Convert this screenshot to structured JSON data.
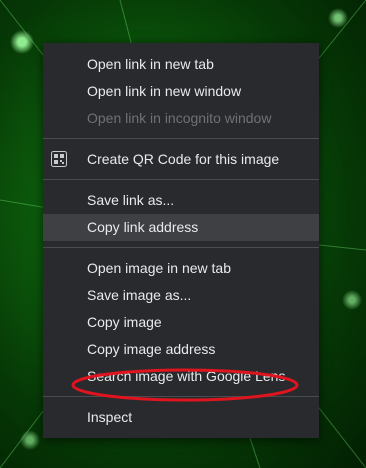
{
  "menu": {
    "groups": [
      [
        "Open link in new tab",
        "Open link in new window",
        "Open link in incognito window"
      ],
      [
        "Create QR Code for this image"
      ],
      [
        "Save link as...",
        "Copy link address"
      ],
      [
        "Open image in new tab",
        "Save image as...",
        "Copy image",
        "Copy image address",
        "Search image with Google Lens"
      ],
      [
        "Inspect"
      ]
    ]
  },
  "icons": {
    "qr": "qr-code-icon"
  },
  "colors": {
    "menu_bg": "#292a2d",
    "highlight": "#3f4044",
    "annotation": "#e0141e"
  },
  "state": {
    "highlighted_item": "Copy link address",
    "disabled_item": "Open link in incognito window"
  }
}
